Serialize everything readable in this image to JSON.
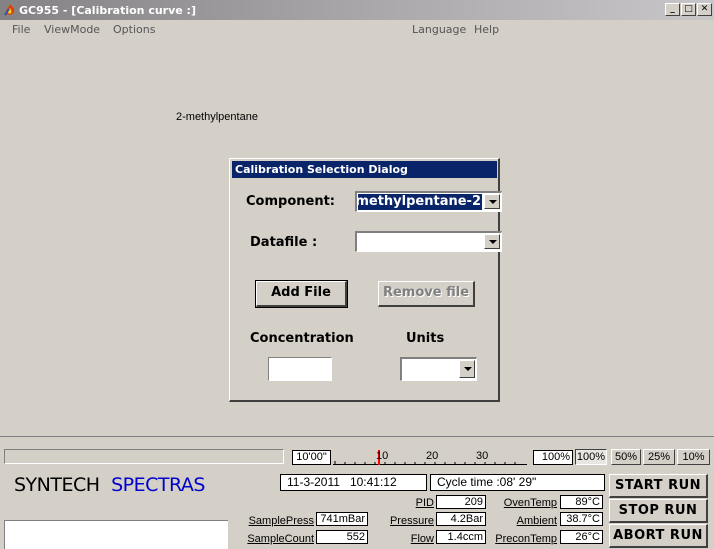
{
  "window": {
    "title": "GC955 - [Calibration curve :]",
    "minimize": "_",
    "maximize": "□",
    "close": "✕",
    "icon": "app-flame-icon"
  },
  "menu": {
    "file": "File",
    "viewmode": "ViewMode",
    "options": "Options",
    "language": "Language",
    "help": "Help"
  },
  "main": {
    "component_caption": "2-methylpentane"
  },
  "dialog": {
    "title": "Calibration Selection Dialog",
    "component_label": "Component:",
    "component_value": "2-methylpentane",
    "datafile_label": "Datafile :",
    "datafile_value": "",
    "add_file": "Add File",
    "remove_file": "Remove file",
    "concentration_label": "Concentration",
    "units_label": "Units",
    "concentration_value": "",
    "units_value": ""
  },
  "status": {
    "time_marker": "10'00\"",
    "scale_ticks": [
      "10",
      "20",
      "30"
    ],
    "percent_display": "100%",
    "zoom_options": [
      "100%",
      "50%",
      "25%",
      "10%"
    ],
    "brand_left": "SYNTECH",
    "brand_right": "SPECTRAS",
    "date": "11-3-2011",
    "time": "10:41:12",
    "cycle_time": "Cycle time :08' 29\"",
    "brand_right_color": "#0000cc"
  },
  "readings": {
    "pid_label": "PID",
    "pid_value": "209",
    "oventemp_label": "OvenTemp",
    "oventemp_value": "89°C",
    "samplepress_label": "SamplePress",
    "samplepress_value": "741mBar",
    "pressure_label": "Pressure",
    "pressure_value": "4.2Bar",
    "ambient_label": "Ambient",
    "ambient_value": "38.7°C",
    "samplecount_label": "SampleCount",
    "samplecount_value": "552",
    "flow_label": "Flow",
    "flow_value": "1.4ccm",
    "precontemp_label": "PreconTemp",
    "precontemp_value": "26°C"
  },
  "actions": {
    "start": "START RUN",
    "stop": "STOP RUN",
    "abort": "ABORT RUN"
  }
}
